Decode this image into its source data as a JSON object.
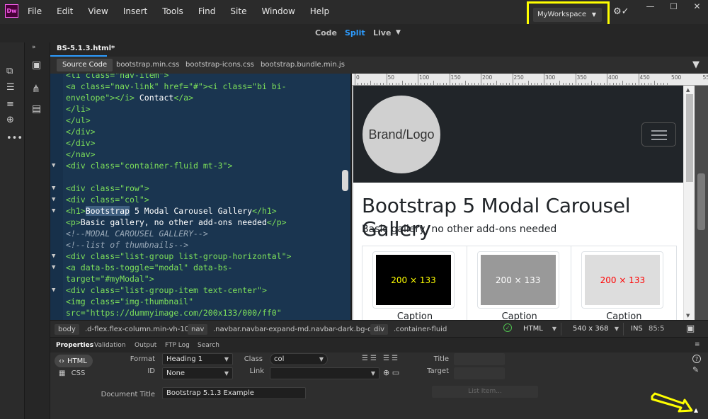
{
  "app": {
    "logo_text": "Dw",
    "menus": [
      "File",
      "Edit",
      "View",
      "Insert",
      "Tools",
      "Find",
      "Site",
      "Window",
      "Help"
    ],
    "workspace": "MyWorkspace"
  },
  "views": {
    "code": "Code",
    "split": "Split",
    "live": "Live"
  },
  "document": {
    "tab": "BS-5.1.3.html*"
  },
  "related_files": [
    "Source Code",
    "bootstrap.min.css",
    "bootstrap-icons.css",
    "bootstrap.bundle.min.js"
  ],
  "code": [
    {
      "fold": "",
      "spans": [
        {
          "t": "<li class=\"nav-item\">",
          "c": ""
        }
      ]
    },
    {
      "fold": "",
      "spans": [
        {
          "t": "<a class=\"nav-link\" href=\"#\"><i class=\"bi bi-",
          "c": ""
        }
      ]
    },
    {
      "fold": "",
      "spans": [
        {
          "t": "envelope\"></i>",
          "c": ""
        },
        {
          "t": " Contact",
          "c": "w"
        },
        {
          "t": "</a>",
          "c": ""
        }
      ]
    },
    {
      "fold": "",
      "spans": [
        {
          "t": "</li>",
          "c": ""
        }
      ]
    },
    {
      "fold": "",
      "spans": [
        {
          "t": "</ul>",
          "c": ""
        }
      ]
    },
    {
      "fold": "",
      "spans": [
        {
          "t": "</div>",
          "c": ""
        }
      ]
    },
    {
      "fold": "",
      "spans": [
        {
          "t": "</div>",
          "c": ""
        }
      ]
    },
    {
      "fold": "",
      "spans": [
        {
          "t": "</nav>",
          "c": ""
        }
      ]
    },
    {
      "fold": "▼",
      "spans": [
        {
          "t": "<div class=\"container-fluid mt-3\">",
          "c": ""
        }
      ]
    },
    {
      "fold": "",
      "spans": [
        {
          "t": "",
          "c": ""
        }
      ]
    },
    {
      "fold": "▼",
      "spans": [
        {
          "t": "<div class=\"row\">",
          "c": ""
        }
      ]
    },
    {
      "fold": "▼",
      "spans": [
        {
          "t": "<div class=\"col\">",
          "c": ""
        }
      ]
    },
    {
      "fold": "▼",
      "spans": [
        {
          "t": "<h1>",
          "c": ""
        },
        {
          "t": "Bootstrap",
          "c": "sel"
        },
        {
          "t": " 5 Modal Carousel Gallery",
          "c": "w"
        },
        {
          "t": "</h1>",
          "c": ""
        }
      ]
    },
    {
      "fold": "",
      "spans": [
        {
          "t": "<p>",
          "c": ""
        },
        {
          "t": "Basic gallery, no other add-ons needed",
          "c": "w"
        },
        {
          "t": "</p>",
          "c": ""
        }
      ]
    },
    {
      "fold": "",
      "spans": [
        {
          "t": "<!--MODAL CAROUSEL GALLERY-->",
          "c": "cm"
        }
      ]
    },
    {
      "fold": "",
      "spans": [
        {
          "t": "<!--list of thumbnails-->",
          "c": "cm"
        }
      ]
    },
    {
      "fold": "▼",
      "spans": [
        {
          "t": "<div class=\"list-group list-group-horizontal\">",
          "c": ""
        }
      ]
    },
    {
      "fold": "▼",
      "spans": [
        {
          "t": "<a data-bs-toggle=\"modal\" data-bs-",
          "c": ""
        }
      ]
    },
    {
      "fold": "",
      "spans": [
        {
          "t": "target=\"#myModal\">",
          "c": ""
        }
      ]
    },
    {
      "fold": "▼",
      "spans": [
        {
          "t": "<div class=\"list-group-item text-center\">",
          "c": ""
        }
      ]
    },
    {
      "fold": "",
      "spans": [
        {
          "t": "<img class=\"img-thumbnail\"",
          "c": ""
        }
      ]
    },
    {
      "fold": "",
      "spans": [
        {
          "t": "src=\"https://dummyimage.com/200x133/000/ff0\"",
          "c": ""
        }
      ]
    }
  ],
  "ruler": {
    "labels": [
      "0",
      "50",
      "100",
      "150",
      "200",
      "250",
      "300",
      "350",
      "400",
      "450",
      "500",
      "55"
    ]
  },
  "live": {
    "brand": "Brand/Logo",
    "title": "Bootstrap 5 Modal Carousel Gallery",
    "subtitle": "Basic gallery, no other add-ons needed",
    "gallery": [
      {
        "label": "200 × 133",
        "bg": "#000000",
        "fg": "#ffff00",
        "caption": "Caption"
      },
      {
        "label": "200 × 133",
        "bg": "#999999",
        "fg": "#ffffff",
        "caption": "Caption"
      },
      {
        "label": "200 × 133",
        "bg": "#dddddd",
        "fg": "#ff0000",
        "caption": "Caption"
      }
    ]
  },
  "status": {
    "crumbs": [
      "body",
      ".d-flex.flex-column.min-vh-100",
      "nav",
      ".navbar.navbar-expand-md.navbar-dark.bg-dark",
      "div",
      ".container-fluid"
    ],
    "doc_type": "HTML",
    "size": "540 x 368",
    "mode": "INS",
    "position": "85:5"
  },
  "properties": {
    "tabs": [
      "Properties",
      "Validation",
      "Output",
      "FTP Log",
      "Search"
    ],
    "html_btn": "HTML",
    "css_btn": "CSS",
    "format_label": "Format",
    "format_value": "Heading 1",
    "id_label": "ID",
    "id_value": "None",
    "class_label": "Class",
    "class_value": "col",
    "link_label": "Link",
    "link_value": "",
    "title_label": "Title",
    "target_label": "Target",
    "doc_title_label": "Document Title",
    "doc_title_value": "Bootstrap 5.1.3 Example",
    "list_item": "List Item..."
  },
  "colors": {
    "accent": "#2d9cff",
    "highlight": "#ffff00",
    "code_bg": "#1a3550",
    "tag_green": "#7de05a"
  }
}
